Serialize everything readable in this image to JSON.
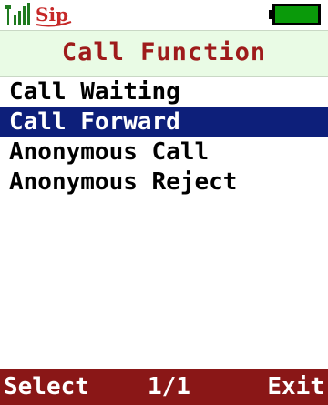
{
  "status_bar": {
    "signal_icon": "signal-strength-icon",
    "sip_label": "Sip",
    "battery_icon": "battery-icon",
    "colors": {
      "signal": "#1f7a1f",
      "sip": "#c62828",
      "battery": "#0a9a0a"
    }
  },
  "header": {
    "title": "Call Function"
  },
  "menu": {
    "items": [
      {
        "label": "Call Waiting",
        "selected": false
      },
      {
        "label": "Call Forward",
        "selected": true
      },
      {
        "label": "Anonymous Call",
        "selected": false
      },
      {
        "label": "Anonymous Reject",
        "selected": false
      }
    ]
  },
  "soft_keys": {
    "left": "Select",
    "page": "1/1",
    "right": "Exit"
  },
  "colors": {
    "title_text": "#9e1b1b",
    "title_background": "#e9fbe5",
    "selection": "#0d1f7a",
    "soft_key_bar": "#8a1717"
  }
}
